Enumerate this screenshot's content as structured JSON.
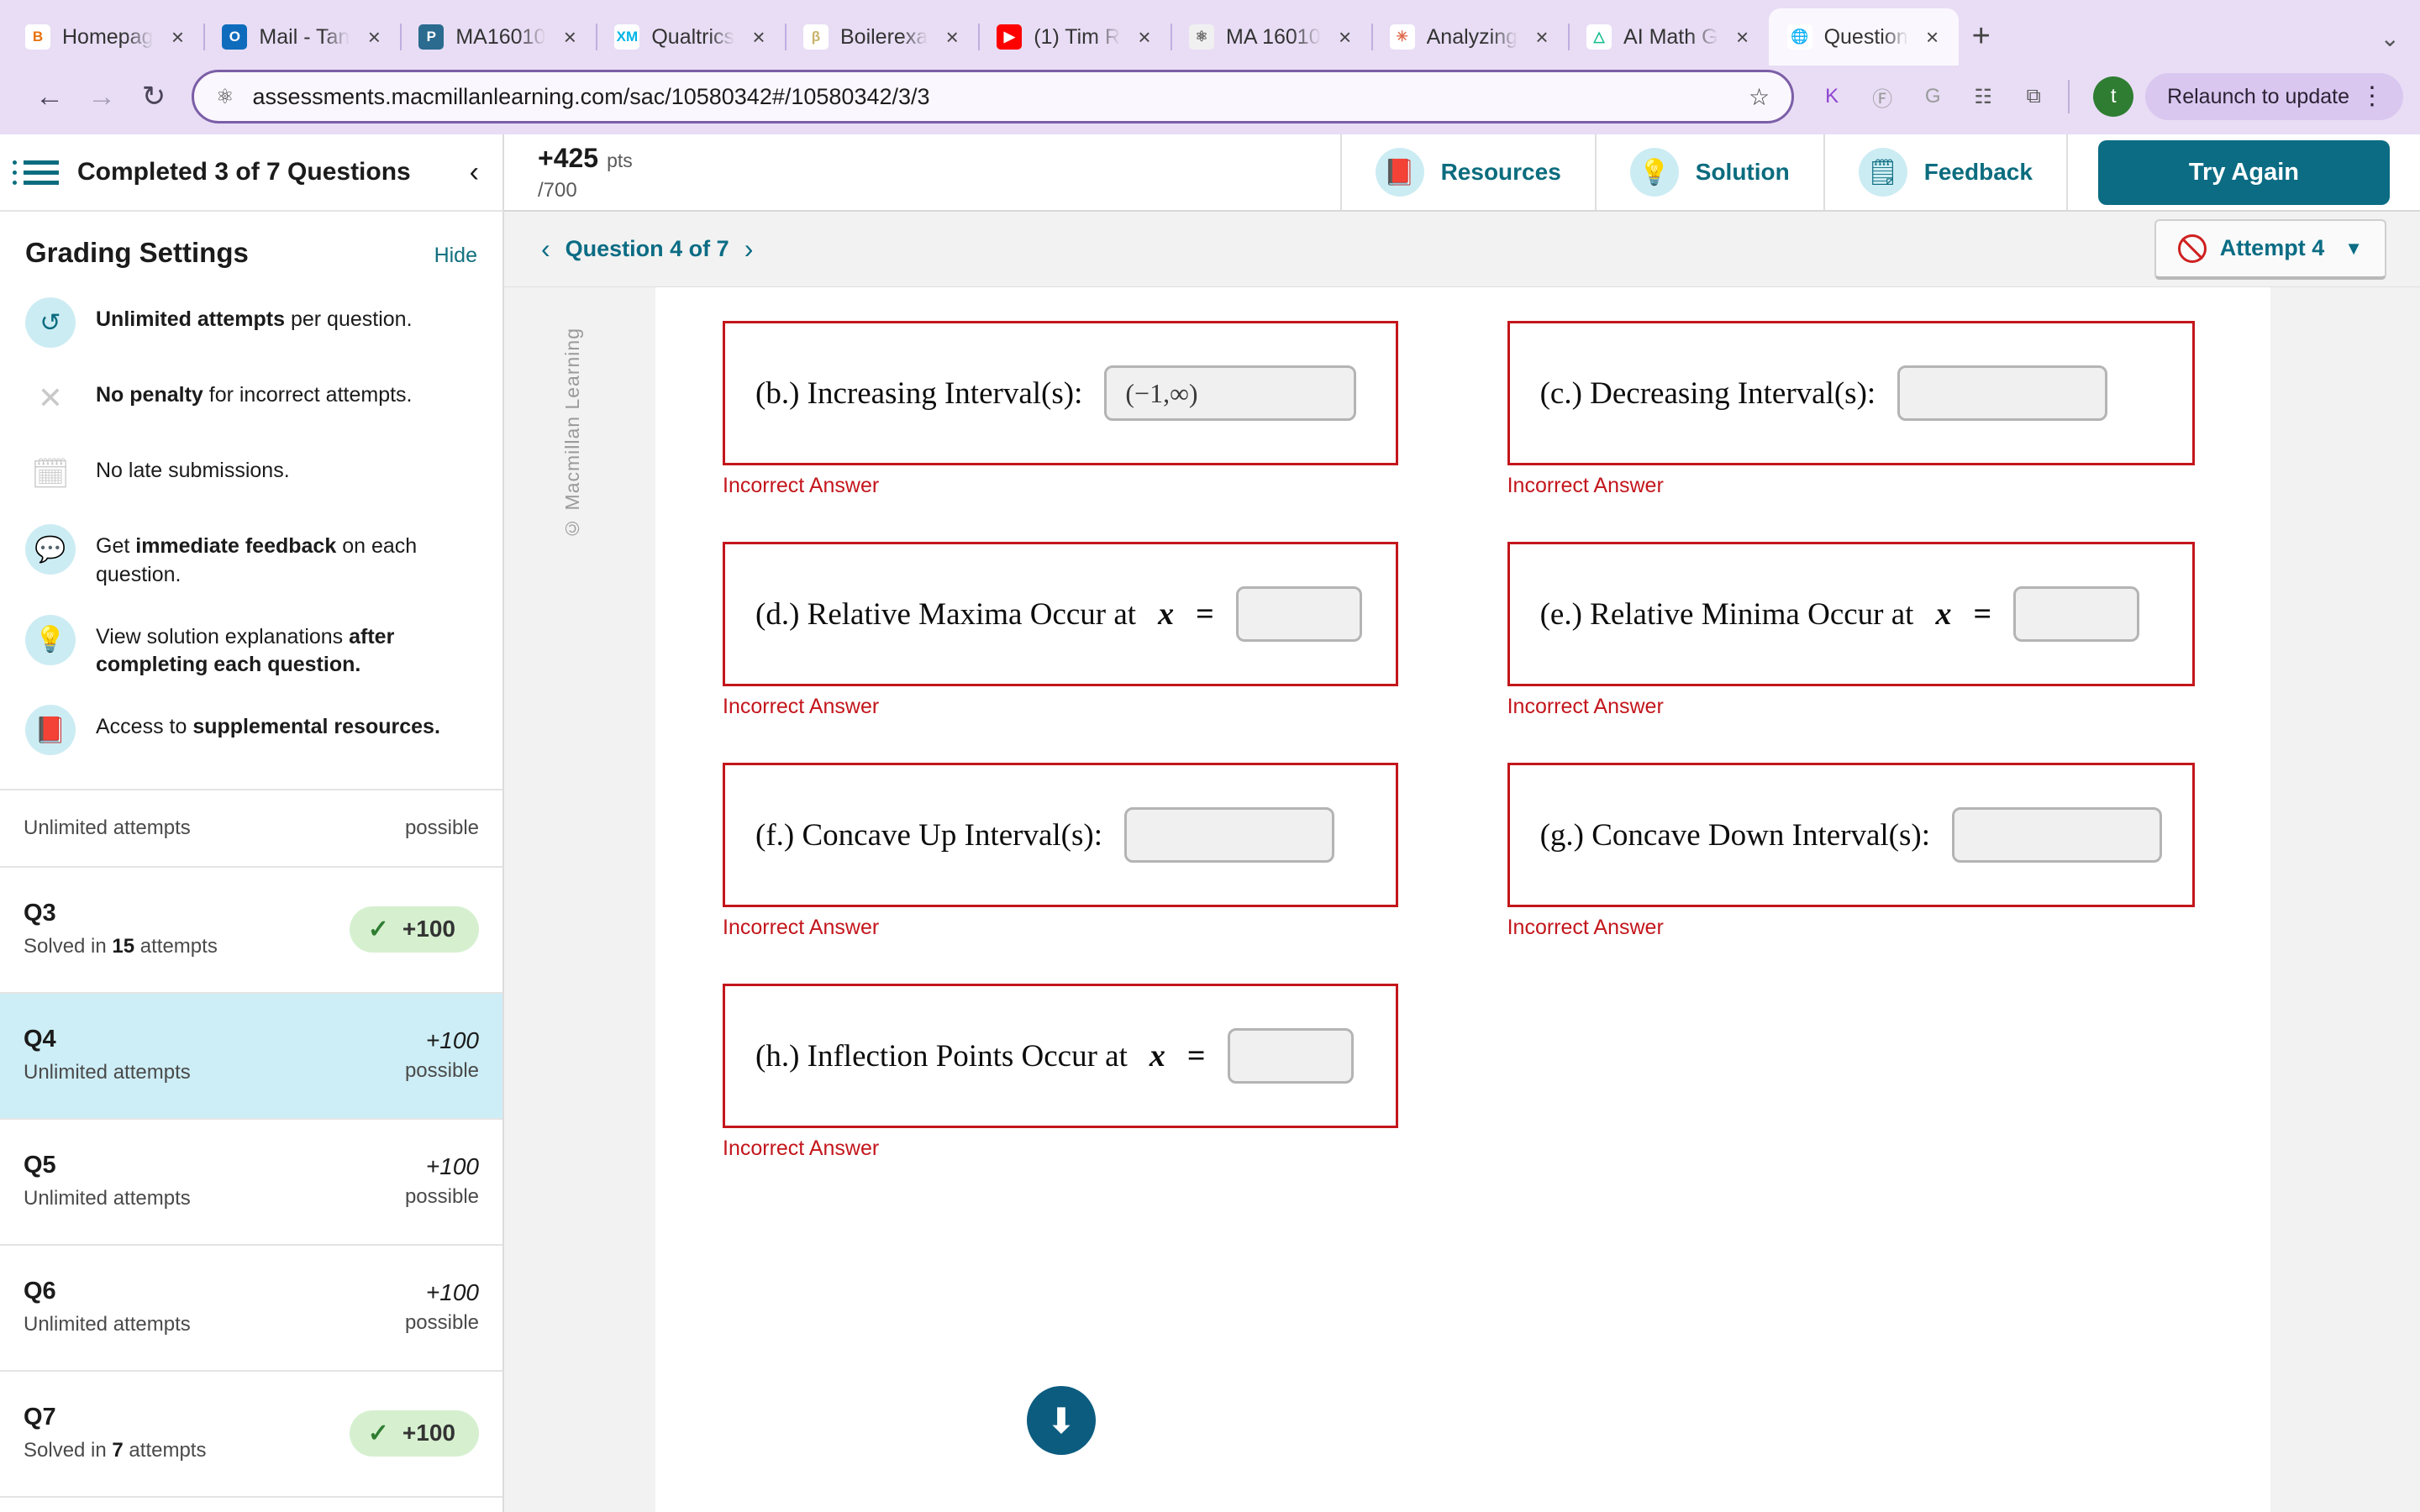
{
  "browser": {
    "tabs": [
      {
        "title": "Homepag",
        "favicon": "brightspace-icon",
        "fav_bg": "#ffffff",
        "fav_fg": "#e8710a",
        "fav_text": "B",
        "active": false
      },
      {
        "title": "Mail - Tan",
        "favicon": "outlook-icon",
        "fav_bg": "#0f6cbd",
        "fav_fg": "#ffffff",
        "fav_text": "O",
        "active": false
      },
      {
        "title": "MA16010",
        "favicon": "purdue-icon",
        "fav_bg": "#2a6b8f",
        "fav_fg": "#ffffff",
        "fav_text": "P",
        "active": false
      },
      {
        "title": "Qualtrics",
        "favicon": "qualtrics-icon",
        "fav_bg": "#ffffff",
        "fav_fg": "#00b4e5",
        "fav_text": "XM",
        "active": false
      },
      {
        "title": "Boilerexa",
        "favicon": "boilerexam-icon",
        "fav_bg": "#ffffff",
        "fav_fg": "#c9b26a",
        "fav_text": "β",
        "active": false
      },
      {
        "title": "(1) Tim R",
        "favicon": "youtube-icon",
        "fav_bg": "#ff0000",
        "fav_fg": "#ffffff",
        "fav_text": "▶",
        "active": false
      },
      {
        "title": "MA 16010",
        "favicon": "atom-icon",
        "fav_bg": "#f0f0f0",
        "fav_fg": "#666666",
        "fav_text": "⚛",
        "active": false
      },
      {
        "title": "Analyzing",
        "favicon": "sparkle-icon",
        "fav_bg": "#ffffff",
        "fav_fg": "#e06c4f",
        "fav_text": "✳",
        "active": false
      },
      {
        "title": "AI Math G",
        "favicon": "compass-icon",
        "fav_bg": "#ffffff",
        "fav_fg": "#15bd8d",
        "fav_text": "△",
        "active": false
      },
      {
        "title": "Question",
        "favicon": "globe-icon",
        "fav_bg": "#ffffff",
        "fav_fg": "#444444",
        "fav_text": "🌐",
        "active": true
      }
    ],
    "new_tab_label": "+",
    "tab_list_label": "⌄",
    "back_label": "←",
    "forward_label": "→",
    "reload_label": "↻",
    "url": "assessments.macmillanlearning.com/sac/10580342#/10580342/3/3",
    "site_info_icon": "permissions-icon",
    "star_label": "☆",
    "extensions": [
      {
        "name": "kami-extension-icon",
        "glyph": "K",
        "color": "#8e44d0"
      },
      {
        "name": "generic-extension-icon",
        "glyph": "Ⓕ",
        "color": "#9a9a9a"
      },
      {
        "name": "grammarly-extension-icon",
        "glyph": "G",
        "color": "#9a9a9a"
      },
      {
        "name": "reading-list-icon",
        "glyph": "☷",
        "color": "#5a5a5a"
      },
      {
        "name": "extensions-puzzle-icon",
        "glyph": "⧉",
        "color": "#5a5a5a"
      }
    ],
    "profile_initial": "t",
    "relaunch_label": "Relaunch to update",
    "relaunch_menu": "⋮"
  },
  "sidebar": {
    "header_title": "Completed 3 of 7 Questions",
    "collapse_icon": "‹",
    "grading": {
      "title": "Grading Settings",
      "hide_label": "Hide",
      "items": [
        {
          "icon": "refresh-icon",
          "glyph": "↺",
          "filled": true,
          "bold": "Unlimited attempts",
          "rest": " per question."
        },
        {
          "icon": "close-x-icon",
          "glyph": "✕",
          "filled": false,
          "bold": "No penalty",
          "rest": " for incorrect attempts."
        },
        {
          "icon": "calendar-icon",
          "glyph": "🗓",
          "filled": false,
          "bold": "",
          "rest": "No late submissions."
        },
        {
          "icon": "chat-icon",
          "glyph": "💬",
          "filled": true,
          "bold": "immediate feedback",
          "rest": " on each question.",
          "pre": "Get "
        },
        {
          "icon": "bulb-icon",
          "glyph": "💡",
          "filled": true,
          "bold": "after completing each question.",
          "rest": "",
          "pre": "View solution explanations "
        },
        {
          "icon": "book-icon",
          "glyph": "📕",
          "filled": true,
          "bold": "supplemental resources.",
          "rest": "",
          "pre": "Access to "
        }
      ]
    },
    "questions": [
      {
        "name": "",
        "sub": "Unlimited attempts",
        "sub_bold": "",
        "score": "",
        "score_sub": "possible",
        "chip": false,
        "partial": true
      },
      {
        "name": "Q3",
        "sub_pre": "Solved in ",
        "sub_bold": "15",
        "sub_post": " attempts",
        "chip": true,
        "chip_value": "+100",
        "chip_check": "✓",
        "active": false
      },
      {
        "name": "Q4",
        "sub_pre": "Unlimited attempts",
        "sub_bold": "",
        "sub_post": "",
        "chip": false,
        "score": "+100",
        "score_sub": "possible",
        "active": true
      },
      {
        "name": "Q5",
        "sub_pre": "Unlimited attempts",
        "sub_bold": "",
        "sub_post": "",
        "chip": false,
        "score": "+100",
        "score_sub": "possible",
        "active": false
      },
      {
        "name": "Q6",
        "sub_pre": "Unlimited attempts",
        "sub_bold": "",
        "sub_post": "",
        "chip": false,
        "score": "+100",
        "score_sub": "possible",
        "active": false
      },
      {
        "name": "Q7",
        "sub_pre": "Solved in ",
        "sub_bold": "7",
        "sub_post": " attempts",
        "chip": true,
        "chip_value": "+100",
        "chip_check": "✓",
        "active": false
      }
    ]
  },
  "header": {
    "points_earned": "+425",
    "points_unit": "pts",
    "points_total": "/700",
    "actions": [
      {
        "label": "Resources",
        "icon": "book-icon",
        "glyph": "📕"
      },
      {
        "label": "Solution",
        "icon": "bulb-icon",
        "glyph": "💡"
      },
      {
        "label": "Feedback",
        "icon": "note-icon",
        "glyph": "🗒"
      }
    ],
    "try_again_label": "Try Again"
  },
  "question_nav": {
    "prev_icon": "‹",
    "next_icon": "›",
    "label": "Question 4 of 7",
    "attempt_label": "Attempt 4",
    "attempt_caret": "▼",
    "attempt_status_icon": "no-credit-icon"
  },
  "question": {
    "watermark": "© Macmillan Learning",
    "scroll_down_icon": "⬇",
    "error_text": "Incorrect Answer",
    "parts": [
      {
        "key": "b",
        "label": "(b.) Increasing Interval(s):",
        "value": "(−1,∞)",
        "placeholder": "",
        "input_size": "wide",
        "has_eq": false,
        "error": "Incorrect Answer"
      },
      {
        "key": "c",
        "label": "(c.) Decreasing Interval(s):",
        "value": "",
        "placeholder": "",
        "input_size": "mid",
        "has_eq": false,
        "error": "Incorrect Answer"
      },
      {
        "key": "d",
        "label": "(d.) Relative Maxima Occur at",
        "value": "",
        "placeholder": "",
        "input_size": "narrow",
        "has_eq": true,
        "var": "x",
        "eq": "=",
        "error": "Incorrect Answer"
      },
      {
        "key": "e",
        "label": "(e.) Relative Minima Occur at",
        "value": "",
        "placeholder": "",
        "input_size": "narrow",
        "has_eq": true,
        "var": "x",
        "eq": "=",
        "error": "Incorrect Answer"
      },
      {
        "key": "f",
        "label": "(f.) Concave Up Interval(s):",
        "value": "",
        "placeholder": "",
        "input_size": "mid",
        "has_eq": false,
        "error": "Incorrect Answer"
      },
      {
        "key": "g",
        "label": "(g.) Concave Down Interval(s):",
        "value": "",
        "placeholder": "",
        "input_size": "mid",
        "has_eq": false,
        "error": "Incorrect Answer"
      },
      {
        "key": "h",
        "label": "(h.) Inflection Points Occur at",
        "value": "",
        "placeholder": "",
        "input_size": "narrow",
        "has_eq": true,
        "var": "x",
        "eq": "=",
        "error": "Incorrect Answer"
      }
    ]
  },
  "colors": {
    "accent_teal": "#0b6c84",
    "error_red": "#c3161c",
    "chrome_purple": "#e8ddf5",
    "active_row": "#cdeef6",
    "chip_green": "#d6f0cf"
  }
}
